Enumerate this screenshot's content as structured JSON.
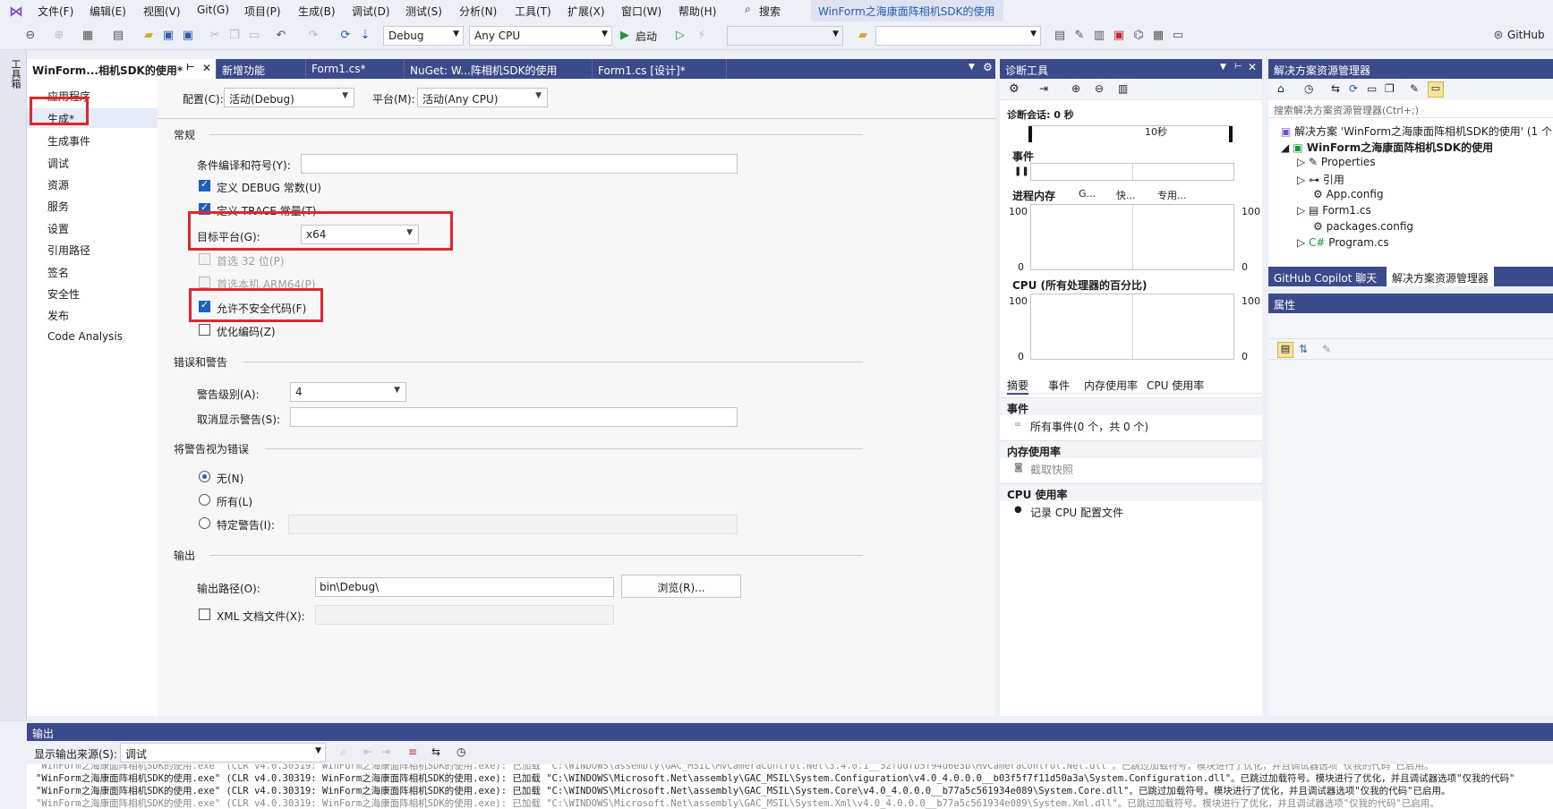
{
  "menu": [
    "文件(F)",
    "编辑(E)",
    "视图(V)",
    "Git(G)",
    "项目(P)",
    "生成(B)",
    "调试(D)",
    "测试(S)",
    "分析(N)",
    "工具(T)",
    "扩展(X)",
    "窗口(W)",
    "帮助(H)"
  ],
  "search_label": "搜索",
  "window_title": "WinForm之海康面阵相机SDK的使用",
  "toolbar": {
    "config": "Debug",
    "platform": "Any CPU",
    "start_label": "启动",
    "github_label": "GitHub"
  },
  "toolbox_label": "工具箱",
  "doc_tabs": [
    "WinForm...相机SDK的使用*",
    "新增功能",
    "Form1.cs*",
    "NuGet: W...阵相机SDK的使用",
    "Form1.cs [设计]*"
  ],
  "props_nav": [
    "应用程序",
    "生成*",
    "生成事件",
    "调试",
    "资源",
    "服务",
    "设置",
    "引用路径",
    "签名",
    "安全性",
    "发布",
    "Code Analysis"
  ],
  "props": {
    "config_label": "配置(C):",
    "config_value": "活动(Debug)",
    "platform_label": "平台(M):",
    "platform_value": "活动(Any CPU)",
    "general_title": "常规",
    "cond_symbols_label": "条件编译和符号(Y):",
    "define_debug": "定义 DEBUG 常数(U)",
    "define_trace": "定义 TRACE 常量(T)",
    "target_platform_label": "目标平台(G):",
    "target_platform_value": "x64",
    "prefer32": "首选 32 位(P)",
    "prefer_arm64": "首选本机 ARM64(P)",
    "allow_unsafe": "允许不安全代码(F)",
    "optimize": "优化编码(Z)",
    "errors_title": "错误和警告",
    "warning_level_label": "警告级别(A):",
    "warning_level_value": "4",
    "suppress_label": "取消显示警告(S):",
    "treat_warnings_title": "将警告视为错误",
    "radio_none": "无(N)",
    "radio_all": "所有(L)",
    "radio_specific": "特定警告(I):",
    "output_title": "输出",
    "output_path_label": "输出路径(O):",
    "output_path_value": "bin\\Debug\\",
    "browse_button": "浏览(R)...",
    "xml_doc": "XML 文档文件(X):"
  },
  "diag": {
    "title": "诊断工具",
    "session": "诊断会话: 0 秒",
    "tick_10s": "10秒",
    "events_title": "事件",
    "memory_title": "进程内存",
    "memory_legend": [
      "G...",
      "快...",
      "专用..."
    ],
    "cpu_title": "CPU (所有处理器的百分比)",
    "axis_100": "100",
    "axis_0": "0",
    "tabs": [
      "摘要",
      "事件",
      "内存使用率",
      "CPU 使用率"
    ],
    "events_section": "事件",
    "all_events": "所有事件(0 个，共 0 个)",
    "memory_section": "内存使用率",
    "snapshot": "截取快照",
    "cpu_section": "CPU 使用率",
    "record_cpu": "记录 CPU 配置文件"
  },
  "solution": {
    "title": "解决方案资源管理器",
    "search_placeholder": "搜索解决方案资源管理器(Ctrl+;)",
    "items": [
      "解决方案 'WinForm之海康面阵相机SDK的使用' (1 个",
      "WinForm之海康面阵相机SDK的使用",
      "Properties",
      "引用",
      "App.config",
      "Form1.cs",
      "packages.config",
      "Program.cs"
    ],
    "tabs": [
      "GitHub Copilot 聊天",
      "解决方案资源管理器"
    ]
  },
  "properties_panel_title": "属性",
  "output": {
    "title": "输出",
    "source_label": "显示输出来源(S):",
    "source_value": "调试",
    "lines": [
      "\"WinForm之海康面阵相机SDK的使用.exe\" (CLR v4.0.30319: WinForm之海康面阵相机SDK的使用.exe): 已加载 \"C:\\WINDOWS\\assembly\\GAC_MSIL\\MvCameraControl.Net\\3.4.0.1__52fddfb5f94d6e3b\\MvCameraControl.Net.dll\"。已跳过加载符号。模块进行了优化，并且调试器选项\"仅我的代码\"已启用。",
      "\"WinForm之海康面阵相机SDK的使用.exe\" (CLR v4.0.30319: WinForm之海康面阵相机SDK的使用.exe): 已加载 \"C:\\WINDOWS\\Microsoft.Net\\assembly\\GAC_MSIL\\System.Configuration\\v4.0_4.0.0.0__b03f5f7f11d50a3a\\System.Configuration.dll\"。已跳过加载符号。模块进行了优化，并且调试器选项\"仅我的代码\"",
      "\"WinForm之海康面阵相机SDK的使用.exe\" (CLR v4.0.30319: WinForm之海康面阵相机SDK的使用.exe): 已加载 \"C:\\WINDOWS\\Microsoft.Net\\assembly\\GAC_MSIL\\System.Core\\v4.0_4.0.0.0__b77a5c561934e089\\System.Core.dll\"。已跳过加载符号。模块进行了优化，并且调试器选项\"仅我的代码\"已启用。",
      "\"WinForm之海康面阵相机SDK的使用.exe\" (CLR v4.0.30319: WinForm之海康面阵相机SDK的使用.exe): 已加载 \"C:\\WINDOWS\\Microsoft.Net\\assembly\\GAC_MSIL\\System.Xml\\v4.0_4.0.0.0__b77a5c561934e089\\System.Xml.dll\"。已跳过加载符号。模块进行了优化，并且调试器选项\"仅我的代码\"已启用。"
    ]
  },
  "colors": {
    "accent": "#3b4a8a",
    "highlight_red": "#e1262c",
    "check_blue": "#1f5fbf"
  }
}
